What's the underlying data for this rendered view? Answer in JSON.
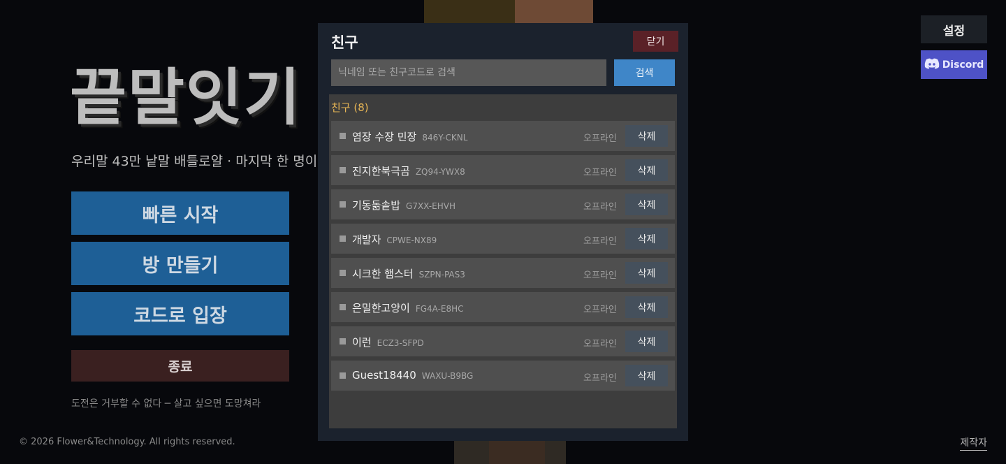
{
  "main": {
    "title": "끝말잇기",
    "subtitle": "우리말 43만 낱말 배틀로얄 · 마지막 한 명이",
    "quick_start": "빠른 시작",
    "create_room": "방 만들기",
    "join_by_code": "코드로 입장",
    "exit": "종료",
    "tagline": "도전은 거부할 수 없다 ─ 살고 싶으면 도망쳐라",
    "copyright": "© 2026 Flower&Technology. All rights reserved.",
    "credits": "제작자"
  },
  "top_right": {
    "settings": "설정",
    "discord": "Discord"
  },
  "friends_modal": {
    "title": "친구",
    "close": "닫기",
    "search_placeholder": "닉네임 또는 친구코드로 검색",
    "search_button": "검색",
    "header": "친구 (8)",
    "friends": [
      {
        "name": "염장 수장 민장",
        "code": "846Y-CKNL",
        "status": "오프라인",
        "delete": "삭제"
      },
      {
        "name": "진지한북극곰",
        "code": "ZQ94-YWX8",
        "status": "오프라인",
        "delete": "삭제"
      },
      {
        "name": "기동돎솥밥",
        "code": "G7XX-EHVH",
        "status": "오프라인",
        "delete": "삭제"
      },
      {
        "name": "개발자",
        "code": "CPWE-NX89",
        "status": "오프라인",
        "delete": "삭제"
      },
      {
        "name": "시크한 햄스터",
        "code": "SZPN-PAS3",
        "status": "오프라인",
        "delete": "삭제"
      },
      {
        "name": "은밀한고양이",
        "code": "FG4A-E8HC",
        "status": "오프라인",
        "delete": "삭제"
      },
      {
        "name": "이런",
        "code": "ECZ3-SFPD",
        "status": "오프라인",
        "delete": "삭제"
      },
      {
        "name": "Guest18440",
        "code": "WAXU-B9BG",
        "status": "오프라인",
        "delete": "삭제"
      }
    ]
  },
  "colors": {
    "primary_button": "#1e5f96",
    "exit_button": "#3a2020",
    "discord": "#4e52c6",
    "search_button": "#3f86c8",
    "close_button": "#5a2127",
    "friends_header": "#e8b655"
  },
  "icons": [
    "discord-icon",
    "status-dot-icon"
  ]
}
